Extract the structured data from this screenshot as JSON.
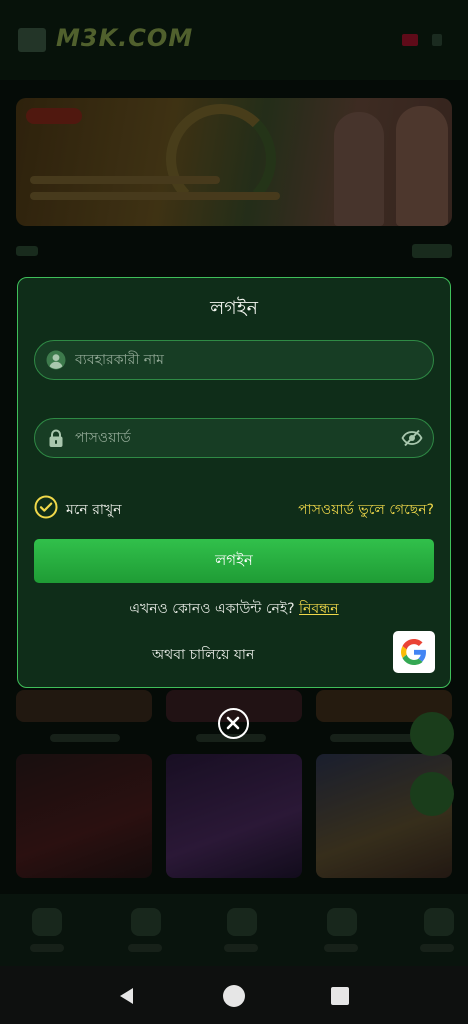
{
  "app": {
    "logo_text": "M3K.COM"
  },
  "login_modal": {
    "title": "লগইন",
    "username_placeholder": "ব্যবহারকারী নাম",
    "password_placeholder": "পাসওয়ার্ড",
    "remember_label": "মনে রাখুন",
    "remember_checked": true,
    "forgot_password_label": "পাসওয়ার্ড ভুলে গেছেন?",
    "login_button_label": "লগইন",
    "no_account_text": "এখনও কোনও একাউন্ট নেই?",
    "signup_link_label": "নিবন্ধন",
    "or_continue_text": "অথবা চালিয়ে যান",
    "google_icon": "google-icon",
    "close_icon": "close-icon"
  },
  "colors": {
    "accent_green": "#2fb548",
    "link_yellow": "#f0d84a",
    "modal_bg": "#0f2d19",
    "modal_border": "#3fbf5a"
  },
  "system_nav": {
    "icons": [
      "back-icon",
      "home-icon",
      "recent-apps-icon"
    ]
  }
}
